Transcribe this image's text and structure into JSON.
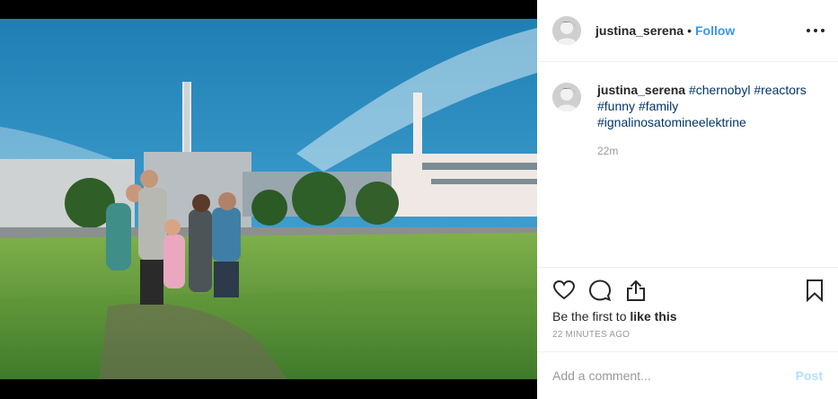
{
  "post": {
    "username": "justina_serena",
    "separator": "•",
    "follow_label": "Follow",
    "caption_hashtags": [
      "#chernobyl",
      "#reactors",
      "#funny",
      "#family",
      "#ignalinosatomineelektrine"
    ],
    "caption_time": "22m"
  },
  "actions": {
    "likes_prefix": "Be the first to ",
    "likes_link": "like this",
    "timestamp": "22 MINUTES AGO"
  },
  "comment": {
    "placeholder": "Add a comment...",
    "post_label": "Post"
  },
  "colors": {
    "link_blue": "#3897f0",
    "hashtag": "#003569",
    "post_disabled": "#b2dffc",
    "muted": "#999999"
  },
  "icons": [
    "more-options-icon",
    "heart-icon",
    "comment-icon",
    "share-icon",
    "bookmark-icon"
  ]
}
